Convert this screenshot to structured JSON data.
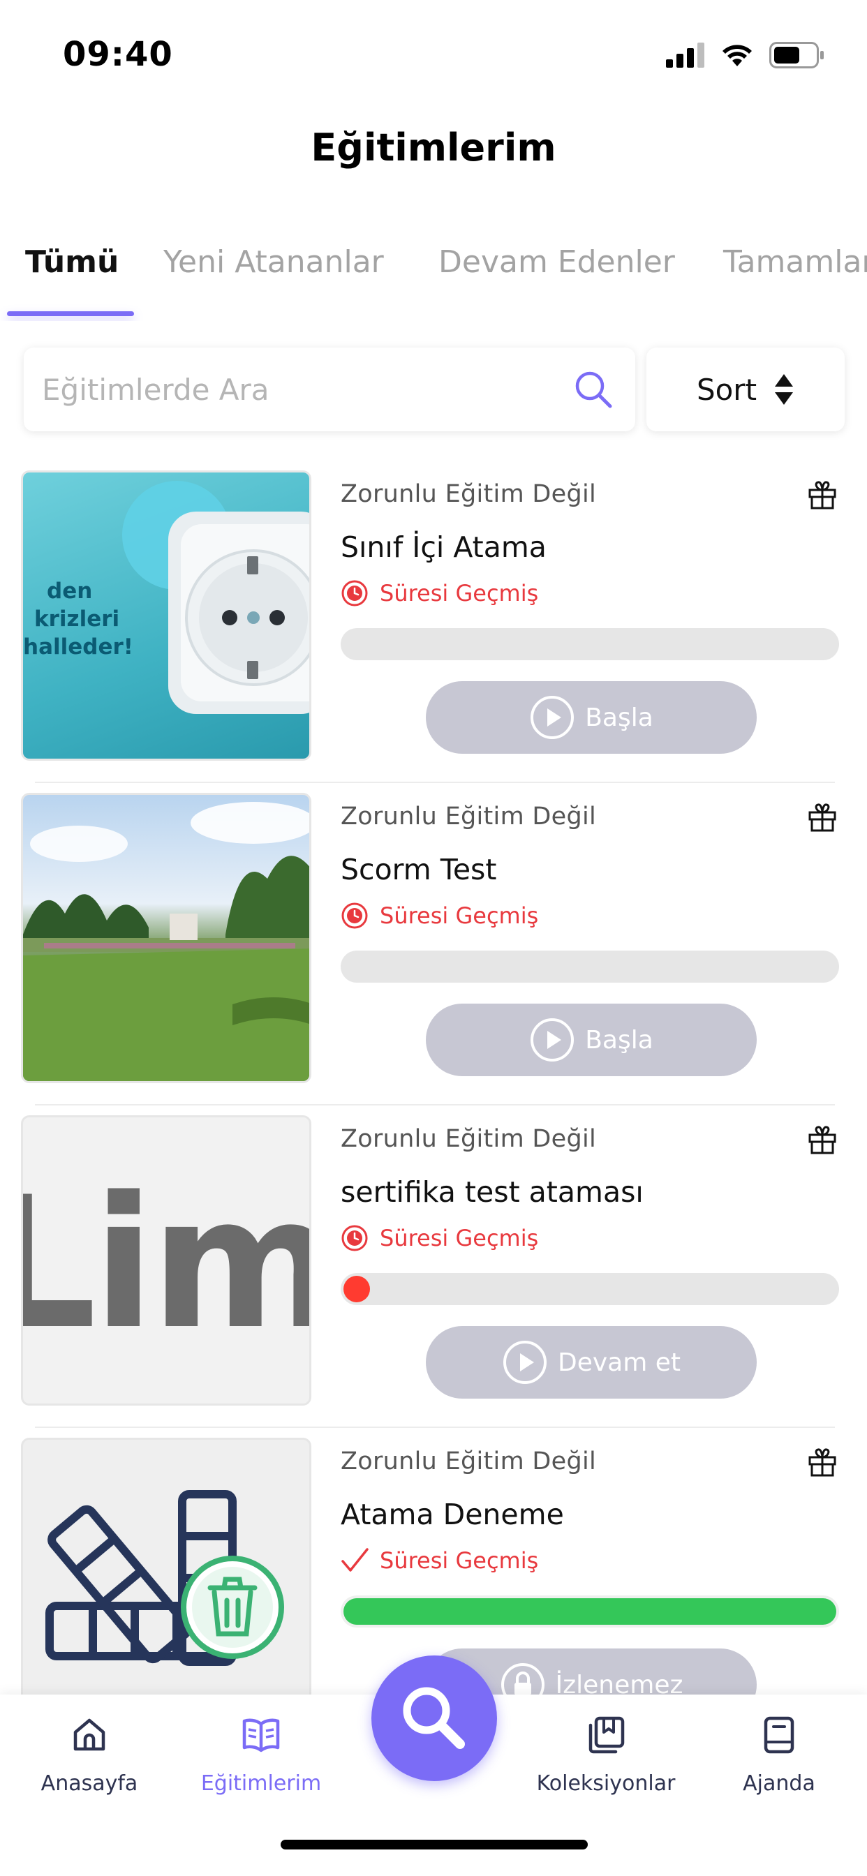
{
  "status_bar": {
    "time": "09:40"
  },
  "header": {
    "title": "Eğitimlerim"
  },
  "tabs": [
    {
      "label": "Tümü",
      "active": true
    },
    {
      "label": "Yeni Atananlar",
      "active": false
    },
    {
      "label": "Devam Edenler",
      "active": false
    },
    {
      "label": "Tamamlananlar",
      "active": false
    }
  ],
  "search": {
    "placeholder": "Eğitimlerde Ara",
    "value": ""
  },
  "sort": {
    "label": "Sort"
  },
  "courses": [
    {
      "mandatory": "Zorunlu Eğitim Değil",
      "title": "Sınıf İçi Atama",
      "status": "Süresi Geçmiş",
      "status_icon": "clock-icon",
      "progress": 0,
      "progress_color": "#e6e6e6",
      "action": "Başla",
      "thumb_text": [
        "den",
        "krizleri",
        "halleder!"
      ]
    },
    {
      "mandatory": "Zorunlu Eğitim Değil",
      "title": "Scorm Test",
      "status": "Süresi Geçmiş",
      "status_icon": "clock-icon",
      "progress": 0,
      "progress_color": "#e6e6e6",
      "action": "Başla"
    },
    {
      "mandatory": "Zorunlu Eğitim Değil",
      "title": "sertifika test ataması",
      "status": "Süresi Geçmiş",
      "status_icon": "clock-icon",
      "progress": 0.02,
      "progress_color": "#ff3b30",
      "action": "Devam et",
      "thumb_text": [
        "Lim"
      ]
    },
    {
      "mandatory": "Zorunlu Eğitim Değil",
      "title": "Atama Deneme",
      "status": "Süresi Geçmiş",
      "status_icon": "check-icon",
      "progress": 1,
      "progress_color": "#34c759",
      "action": "İzlenemez"
    }
  ],
  "bottom_nav": [
    {
      "label": "Anasayfa",
      "icon": "home-icon",
      "active": false
    },
    {
      "label": "Eğitimlerim",
      "icon": "book-icon",
      "active": true
    },
    {
      "label": "Koleksiyonlar",
      "icon": "collection-icon",
      "active": false
    },
    {
      "label": "Ajanda",
      "icon": "agenda-icon",
      "active": false
    }
  ],
  "colors": {
    "accent": "#7b6cf6",
    "danger": "#e8393e",
    "success": "#34c759",
    "button_disabled": "#c7c7d3"
  }
}
